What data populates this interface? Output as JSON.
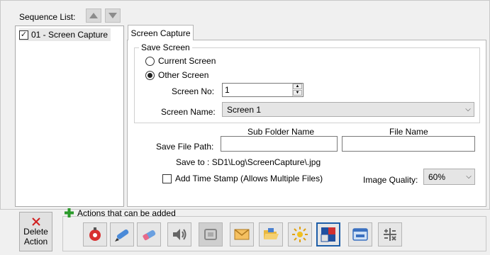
{
  "sequence": {
    "label": "Sequence List:",
    "items": [
      {
        "label": "01 - Screen Capture",
        "checked": true
      }
    ]
  },
  "tab": {
    "label": "Screen Capture"
  },
  "save_screen": {
    "title": "Save Screen",
    "option_current": "Current Screen",
    "option_other": "Other Screen",
    "selected": "Other Screen",
    "screen_no_label": "Screen No:",
    "screen_no_value": "1",
    "screen_name_label": "Screen Name:",
    "screen_name_value": "Screen 1"
  },
  "file": {
    "sub_folder_header": "Sub Folder Name",
    "file_name_header": "File Name",
    "path_label": "Save File Path:",
    "sub_folder_value": "",
    "file_name_value": "",
    "save_to": "Save to : SD1\\Log\\ScreenCapture\\.jpg",
    "timestamp_label": "Add Time Stamp (Allows Multiple Files)",
    "timestamp_checked": false,
    "quality_label": "Image Quality:",
    "quality_value": "60%"
  },
  "actions": {
    "label": "Actions that can be added",
    "delete_line1": "Delete",
    "delete_line2": "Action",
    "tools": [
      "alarm-icon",
      "pen-icon",
      "eraser-icon",
      "speaker-icon",
      "screen-capture-icon",
      "email-icon",
      "folder-open-icon",
      "brightness-icon",
      "screen-switch-icon",
      "window-icon",
      "calculator-icon"
    ],
    "selected_tool": "screen-switch-icon"
  },
  "colors": {
    "accent": "#1e5ea8",
    "add": "#2a9a2a",
    "delete": "#d02020"
  }
}
